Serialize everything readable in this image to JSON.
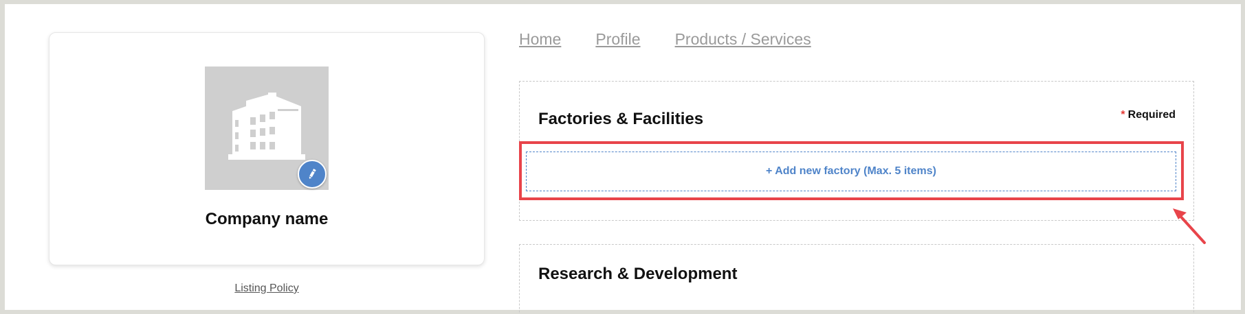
{
  "company": {
    "name": "Company name",
    "logo_icon": "building-icon",
    "edit_icon": "pencil-icon",
    "listing_policy": "Listing Policy"
  },
  "nav": {
    "items": [
      {
        "label": "Home"
      },
      {
        "label": "Profile"
      },
      {
        "label": "Products / Services"
      }
    ]
  },
  "sections": {
    "factories": {
      "title": "Factories & Facilities",
      "required_star": "*",
      "required_label": "Required",
      "add_button": "+ Add new factory (Max. 5 items)"
    },
    "rnd": {
      "title": "Research & Development"
    }
  },
  "colors": {
    "accent": "#4f84c9",
    "highlight": "#e8444a",
    "required_star": "#e53935",
    "placeholder_bg": "#cfcfcf"
  }
}
